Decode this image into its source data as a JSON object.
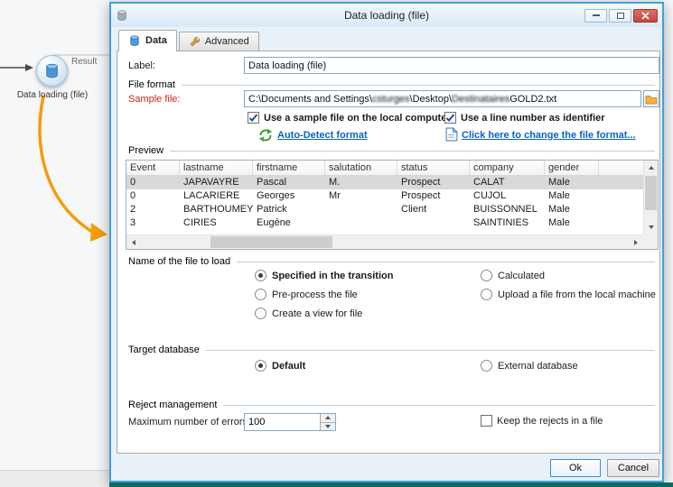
{
  "colors": {
    "dialog_border": "#41a0dc",
    "close_button_red": "#c4453e",
    "link_blue": "#0a62c5",
    "sample_file_label_red": "#d42020",
    "connector_arrow_orange": "#f59c07"
  },
  "icons": {
    "app": "database-app-icon",
    "tab_data": "database-icon",
    "tab_advanced": "tools-icon",
    "browse": "folder-icon",
    "autodetect": "refresh-icon",
    "change_format": "document-icon",
    "minimize": "dash-glyph",
    "maximize": "square-glyph",
    "close": "x-glyph"
  },
  "canvas": {
    "node_label": "Data loading (file)",
    "result_label": "Result"
  },
  "dialog": {
    "title": "Data loading (file)",
    "tabs": [
      {
        "label": "Data"
      },
      {
        "label": "Advanced"
      }
    ],
    "label_row": {
      "label": "Label:",
      "value": "Data loading (file)"
    },
    "file_format": {
      "title": "File format",
      "sample_file_label": "Sample file:",
      "path": {
        "prefix": "C:\\Documents and Settings\\",
        "user": "csturges",
        "mid": "\\Desktop\\",
        "file": "Destinataires",
        "ext": "GOLD2.txt"
      },
      "checkbox_sample_file": "Use a sample file on the local computer",
      "checkbox_line_identifier": "Use a line number as identifier",
      "autodetect_link": "Auto-Detect format",
      "change_format_link": "Click here to change the file format..."
    },
    "preview": {
      "title": "Preview",
      "columns": [
        "Event",
        "lastname",
        "firstname",
        "salutation",
        "status",
        "company",
        "gender"
      ],
      "rows": [
        [
          "0",
          "JAPAVAYRE",
          "Pascal",
          "M.",
          "Prospect",
          "CALAT",
          "Male"
        ],
        [
          "0",
          "LACARIERE",
          "Georges",
          "Mr",
          "Prospect",
          "CUJOL",
          "Male"
        ],
        [
          "2",
          "BARTHOUMEYRIE",
          "Patrick",
          "",
          "Client",
          "BUISSONNEL",
          "Male"
        ],
        [
          "3",
          "CIRIES",
          "Eugène",
          "",
          "",
          "SAINTINIES",
          "Male"
        ]
      ]
    },
    "file_name_section": {
      "title": "Name of the file to load",
      "options_left": [
        "Specified in the transition",
        "Pre-process the file",
        "Create a view for file"
      ],
      "options_right": [
        "Calculated",
        "Upload a file from the local machine"
      ],
      "selected": "Specified in the transition"
    },
    "target_database": {
      "title": "Target database",
      "options_left": [
        "Default"
      ],
      "options_right": [
        "External database"
      ],
      "selected": "Default"
    },
    "reject_management": {
      "title": "Reject management",
      "max_errors_label": "Maximum number of errors:",
      "max_errors_value": "100",
      "checkbox_keep_rejects": "Keep the rejects in a file"
    },
    "buttons": {
      "ok": "Ok",
      "cancel": "Cancel"
    }
  }
}
